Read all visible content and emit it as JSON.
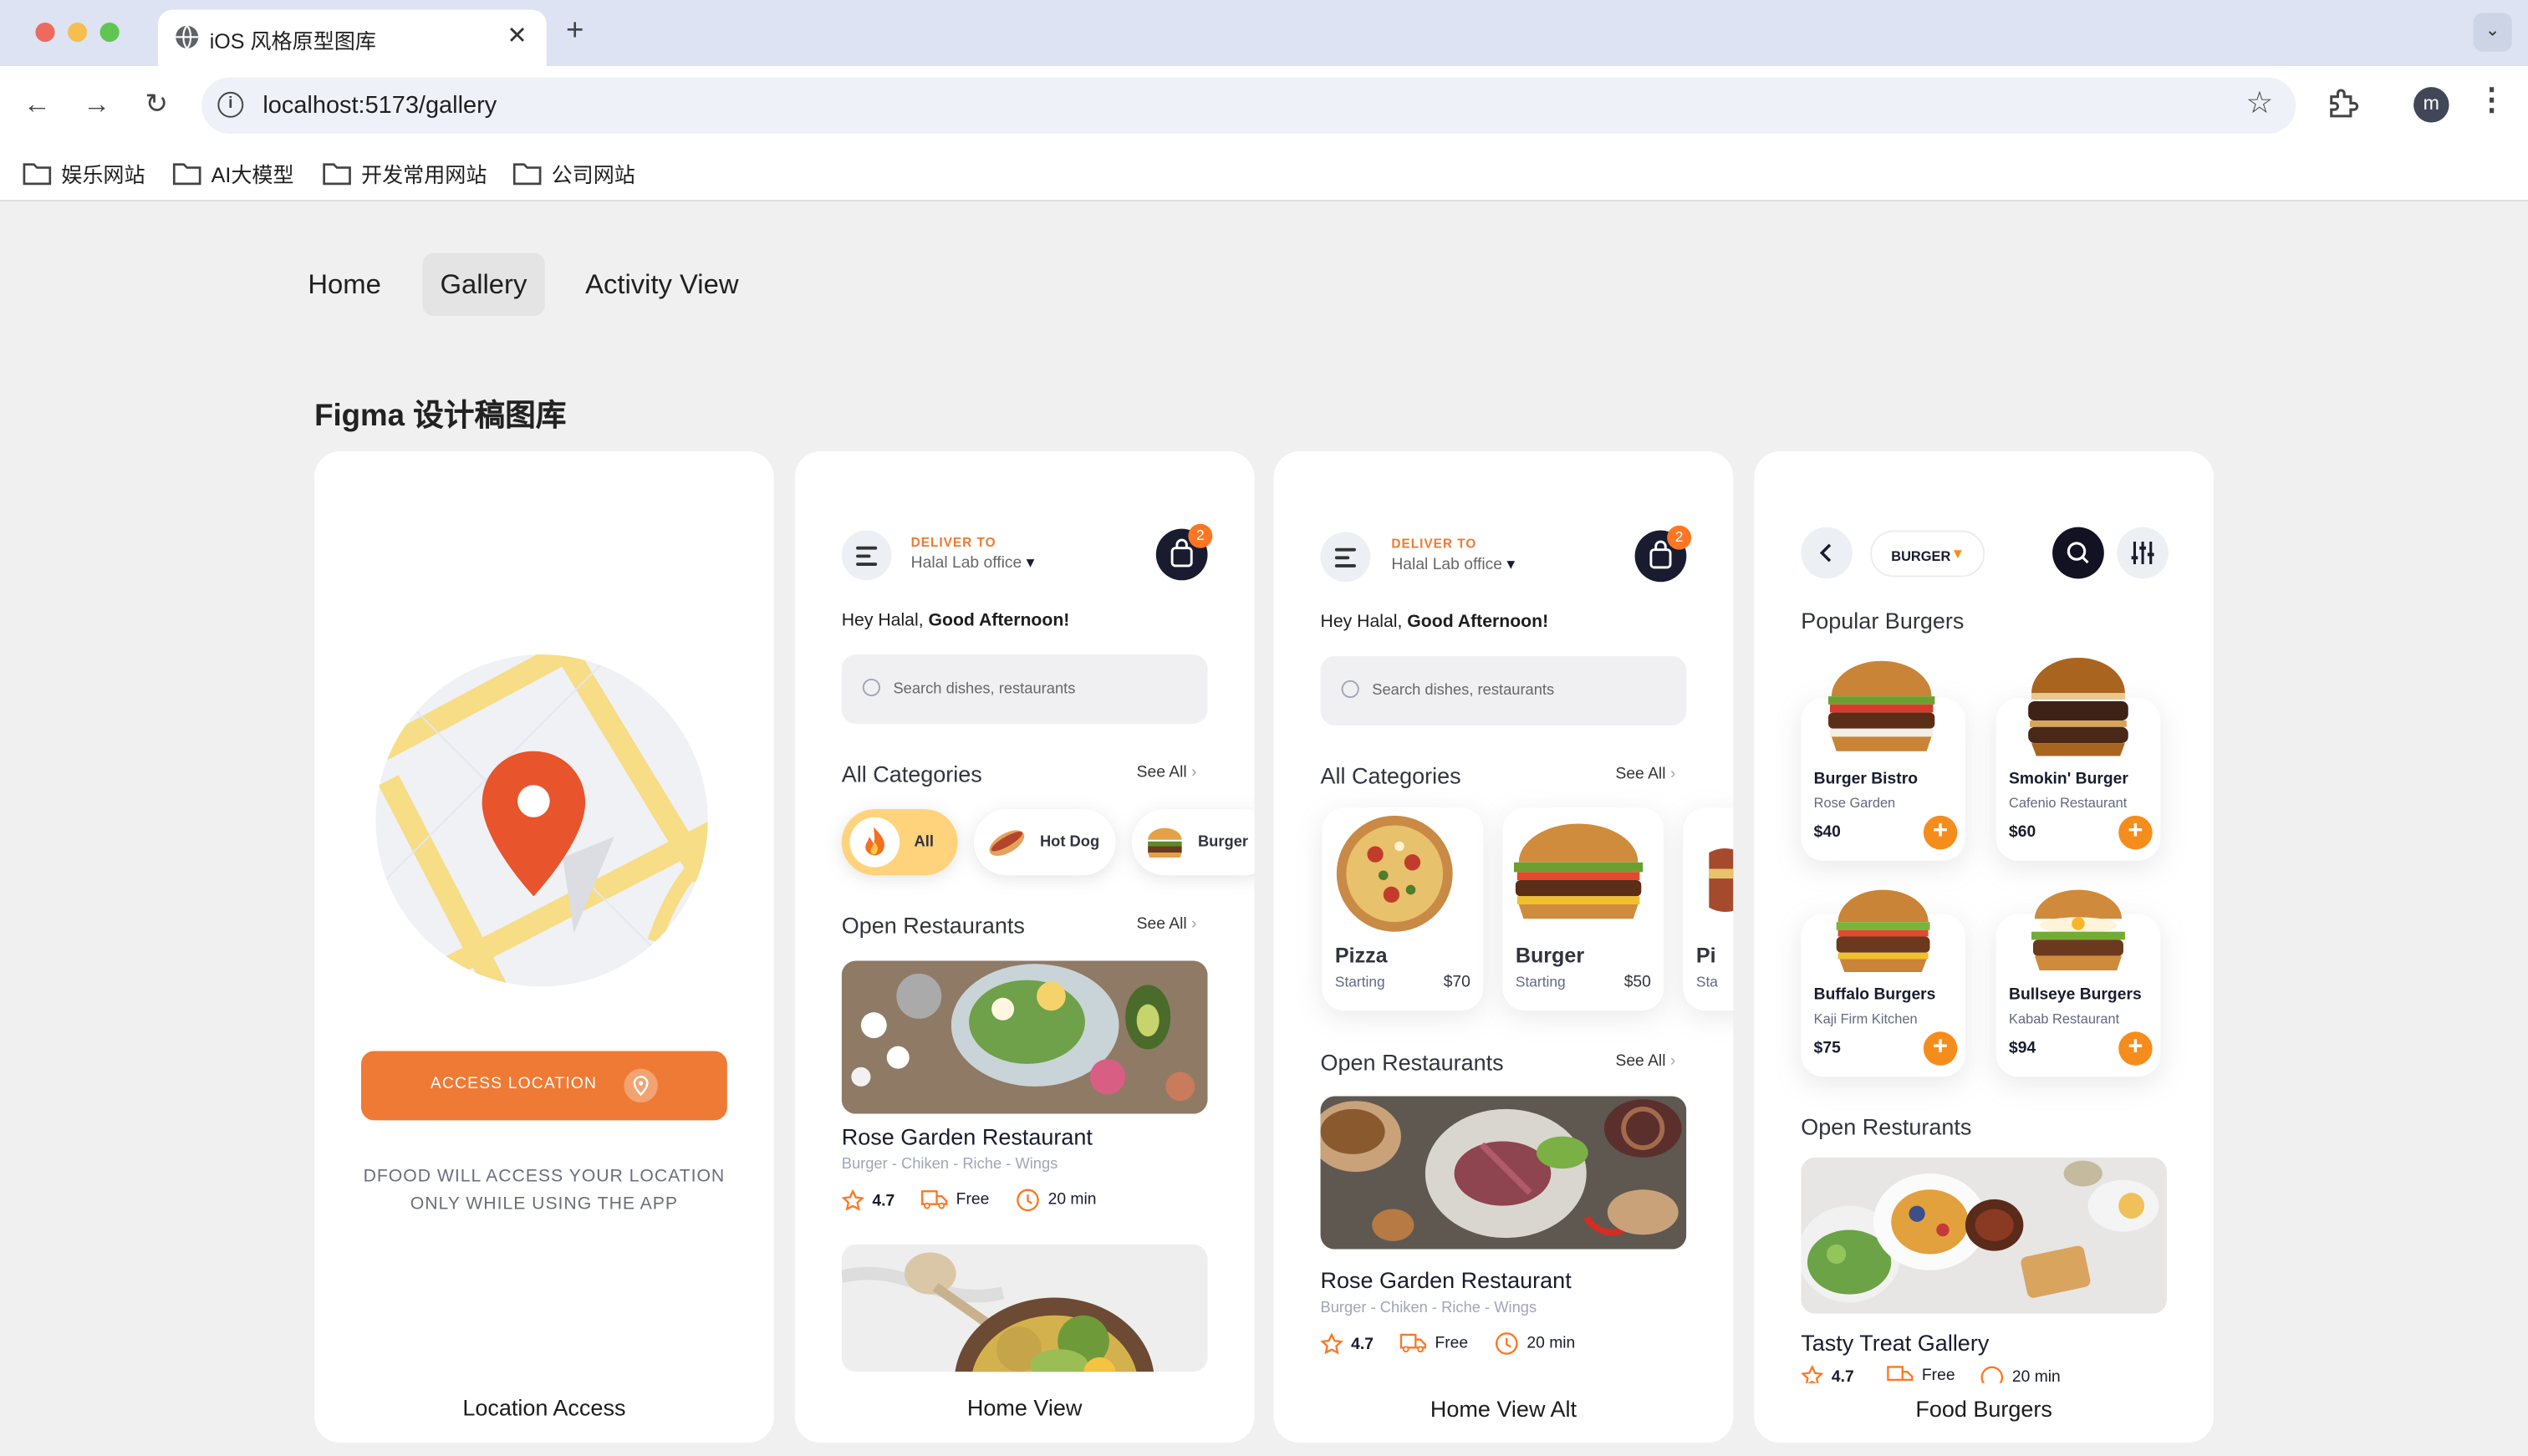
{
  "browser": {
    "tab_title": "iOS 风格原型图库",
    "url": "localhost:5173/gallery",
    "profile_initial": "m",
    "bookmarks": [
      "娱乐网站",
      "AI大模型",
      "开发常用网站",
      "公司网站"
    ],
    "traffic_colors": [
      "#ed6a5e",
      "#f5bf4f",
      "#61c554"
    ]
  },
  "nav": {
    "home": "Home",
    "gallery": "Gallery",
    "activity": "Activity View",
    "active": "gallery"
  },
  "page_title": "Figma 设计稿图库",
  "colors": {
    "accent": "#ee7a35",
    "dark": "#181c2e",
    "chip_active": "#ffd27c"
  },
  "cards": {
    "location": {
      "button": "ACCESS LOCATION",
      "note": "DFOOD WILL ACCESS YOUR LOCATION ONLY WHILE USING THE APP",
      "caption": "Location Access"
    },
    "home": {
      "deliver_to": "DELIVER TO",
      "location": "Halal Lab office",
      "cart_count": "2",
      "greeting_prefix": "Hey Halal, ",
      "greeting_bold": "Good Afternoon!",
      "search_placeholder": "Search dishes, restaurants",
      "categories_title": "All Categories",
      "see_all": "See All",
      "chips": [
        "All",
        "Hot Dog",
        "Burger"
      ],
      "open_title": "Open Restaurants",
      "restaurant": {
        "name": "Rose Garden Restaurant",
        "tags": "Burger - Chiken - Riche - Wings",
        "rating": "4.7",
        "delivery": "Free",
        "time": "20 min"
      },
      "caption": "Home View"
    },
    "home_alt": {
      "deliver_to": "DELIVER TO",
      "location": "Halal Lab office",
      "cart_count": "2",
      "greeting_prefix": "Hey Halal, ",
      "greeting_bold": "Good Afternoon!",
      "search_placeholder": "Search dishes, restaurants",
      "categories_title": "All Categories",
      "see_all": "See All",
      "categories": [
        {
          "name": "Pizza",
          "label": "Starting",
          "price": "$70"
        },
        {
          "name": "Burger",
          "label": "Starting",
          "price": "$50"
        },
        {
          "name": "Pi",
          "label": "Sta",
          "price": ""
        }
      ],
      "open_title": "Open Restaurants",
      "restaurant": {
        "name": "Rose Garden Restaurant",
        "tags": "Burger - Chiken - Riche - Wings",
        "rating": "4.7",
        "delivery": "Free",
        "time": "20 min"
      },
      "caption": "Home View Alt"
    },
    "burgers": {
      "filter": "BURGER",
      "popular_title": "Popular Burgers",
      "items": [
        {
          "name": "Burger Bistro",
          "restaurant": "Rose Garden",
          "price": "$40"
        },
        {
          "name": "Smokin' Burger",
          "restaurant": "Cafenio Restaurant",
          "price": "$60"
        },
        {
          "name": "Buffalo Burgers",
          "restaurant": "Kaji Firm Kitchen",
          "price": "$75"
        },
        {
          "name": "Bullseye Burgers",
          "restaurant": "Kabab Restaurant",
          "price": "$94"
        }
      ],
      "open_title": "Open Resturants",
      "restaurant": {
        "name": "Tasty Treat Gallery",
        "rating": "4.7",
        "delivery": "Free",
        "time": "20 min"
      },
      "caption": "Food Burgers"
    }
  }
}
